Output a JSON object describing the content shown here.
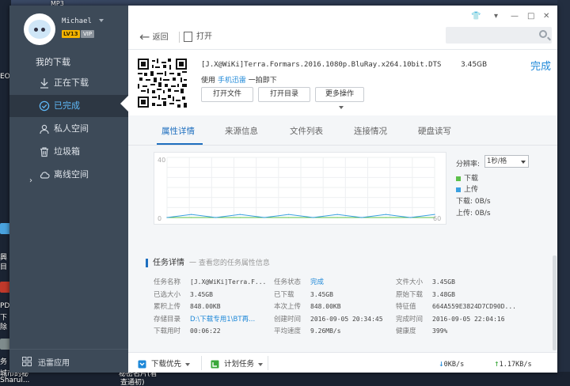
{
  "desktop": {
    "top_file_label": "MP3",
    "left_labels": [
      "EO",
      "興",
      "目",
      "PD",
      "下",
      "除",
      "务"
    ],
    "bottom_labels": [
      "城市的秘",
      "Sharul...",
      "秘密名片(看",
      "查通初)"
    ]
  },
  "user": {
    "name": "Michael",
    "level": "LV13",
    "vip": "VIP"
  },
  "sidebar": {
    "title": "我的下载",
    "items": [
      {
        "label": "正在下载"
      },
      {
        "label": "已完成"
      },
      {
        "label": "私人空间"
      },
      {
        "label": "垃圾箱"
      },
      {
        "label": "离线空间"
      }
    ],
    "bottom_label": "迅雷应用"
  },
  "topbar": {
    "back_label": "返回",
    "open_label": "打开",
    "search_placeholder": ""
  },
  "file": {
    "name": "[J.X@WiKi]Terra.Formars.2016.1080p.BluRay.x264.10bit.DTS",
    "size": "3.45GB",
    "status": "完成",
    "scan_prefix": "使用",
    "scan_link": "手机迅雷",
    "scan_suffix": "一拍即下",
    "buttons": {
      "open_file": "打开文件",
      "open_dir": "打开目录",
      "more": "更多操作"
    }
  },
  "tabs": [
    "属性详情",
    "来源信息",
    "文件列表",
    "连接情况",
    "硬盘读写"
  ],
  "chart": {
    "y_label_top": "40",
    "y_label_bottom": "0",
    "x_label_right": "60",
    "rate_label": "分辨率:",
    "rate_value": "1秒/格",
    "legend_download": "下载",
    "legend_upload": "上传",
    "download_speed": "下载: 0B/s",
    "upload_speed": "上传: 0B/s",
    "colors": {
      "download": "#5cc04a",
      "upload": "#3aa0e0"
    }
  },
  "chart_data": {
    "type": "area",
    "xlabel": "",
    "ylabel": "",
    "ylim": [
      0,
      40
    ],
    "series": [
      {
        "name": "下载",
        "values": [
          0,
          0,
          0,
          0,
          0,
          0,
          0,
          0,
          0,
          0,
          0,
          0
        ]
      },
      {
        "name": "上传",
        "values": [
          0,
          1,
          0,
          1,
          0,
          1,
          0,
          1,
          0,
          1,
          0,
          1
        ]
      }
    ]
  },
  "task": {
    "title": "任务详情",
    "hint": "一 查看您的任务属性信息",
    "rows": [
      [
        {
          "k": "任务名称",
          "v": "[J.X@WiKi]Terra.F..."
        },
        {
          "k": "任务状态",
          "v": "完成",
          "blue": true
        },
        {
          "k": "文件大小",
          "v": "3.45GB"
        }
      ],
      [
        {
          "k": "已选大小",
          "v": "3.45GB"
        },
        {
          "k": "已下载",
          "v": "3.45GB"
        },
        {
          "k": "原始下载",
          "v": "3.48GB"
        }
      ],
      [
        {
          "k": "累积上传",
          "v": "848.00KB"
        },
        {
          "k": "本次上传",
          "v": "848.00KB"
        },
        {
          "k": "特征值",
          "v": "664A559E3824D7CD90D..."
        }
      ],
      [
        {
          "k": "存储目录",
          "v": "D:\\下载专用1\\BT再...",
          "blue": true
        },
        {
          "k": "创建时间",
          "v": "2016-09-05 20:34:45"
        },
        {
          "k": "完成时间",
          "v": "2016-09-05 22:04:16"
        }
      ],
      [
        {
          "k": "下载用时",
          "v": "00:06:22"
        },
        {
          "k": "平均速度",
          "v": "9.26MB/s"
        },
        {
          "k": "健康度",
          "v": "399%"
        }
      ]
    ]
  },
  "status": {
    "priority": "下载优先",
    "plan": "计划任务",
    "down_speed": "0KB/s",
    "up_speed": "1.17KB/s"
  }
}
